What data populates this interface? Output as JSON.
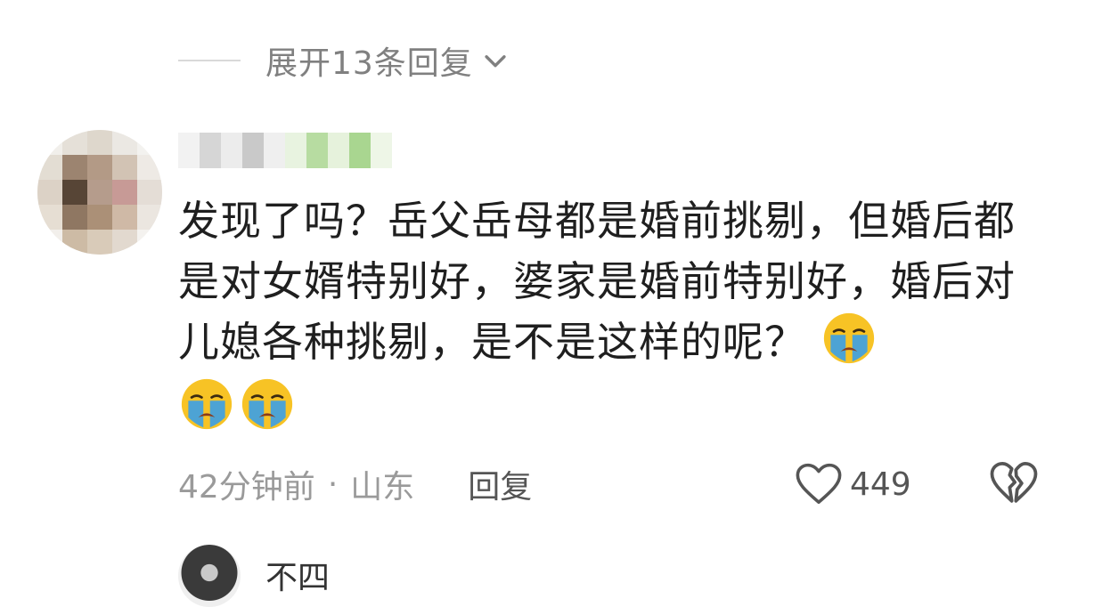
{
  "replies_toggle": {
    "label": "展开13条回复",
    "icon": "chevron-down-icon"
  },
  "comment": {
    "text": "发现了吗？岳父岳母都是婚前挑剔，但婚后都是对女婿特别好，婆家是婚前特别好，婚后对儿媳各种挑剔，是不是这样的呢？",
    "emoji": "loudly-crying-face",
    "time": "42分钟前",
    "separator": "·",
    "location": "山东",
    "reply_label": "回复",
    "like_count": "449"
  },
  "next_comment": {
    "name_partial": "不四"
  },
  "colors": {
    "text": "#1f1f1f",
    "meta": "#9a9a9a",
    "action": "#555555",
    "emoji_face": "#f7c325",
    "emoji_tear": "#3aa0e8"
  }
}
